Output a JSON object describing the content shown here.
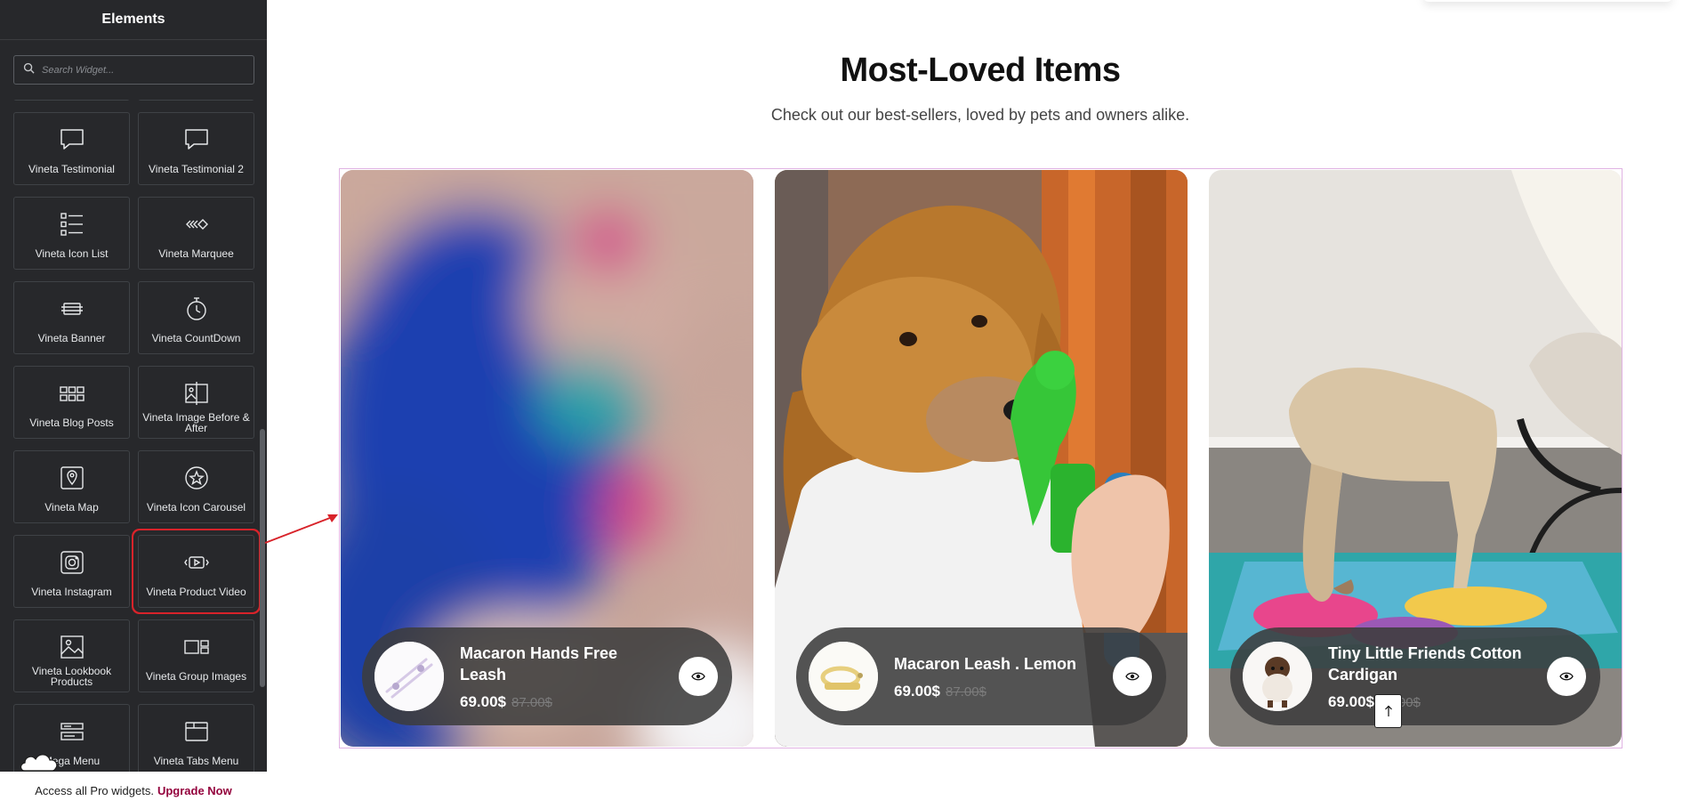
{
  "sidebar": {
    "title": "Elements",
    "search_placeholder": "Search Widget...",
    "widgets": [
      {
        "label": "Vineta Testimonial",
        "icon": "speech-bubble-icon"
      },
      {
        "label": "Vineta Testimonial 2",
        "icon": "speech-bubble-icon"
      },
      {
        "label": "Vineta Icon List",
        "icon": "icon-list-icon"
      },
      {
        "label": "Vineta Marquee",
        "icon": "marquee-icon"
      },
      {
        "label": "Vineta Banner",
        "icon": "banner-icon"
      },
      {
        "label": "Vineta CountDown",
        "icon": "stopwatch-icon"
      },
      {
        "label": "Vineta Blog Posts",
        "icon": "blog-grid-icon"
      },
      {
        "label": "Vineta Image Before & After",
        "icon": "image-compare-icon"
      },
      {
        "label": "Vineta Map",
        "icon": "map-pin-icon"
      },
      {
        "label": "Vineta Icon Carousel",
        "icon": "star-circle-icon"
      },
      {
        "label": "Vineta Instagram",
        "icon": "instagram-icon"
      },
      {
        "label": "Vineta Product Video",
        "icon": "video-play-icon"
      },
      {
        "label": "Vineta Lookbook Products",
        "icon": "lookbook-icon"
      },
      {
        "label": "Vineta Group Images",
        "icon": "group-images-icon"
      },
      {
        "label": "Mega Menu",
        "icon": "mega-menu-icon"
      },
      {
        "label": "Vineta Tabs Menu",
        "icon": "tabs-menu-icon"
      }
    ],
    "highlighted_widget": "Vineta Product Video",
    "promo_text": "Access all Pro widgets.",
    "promo_link": "Upgrade Now"
  },
  "section": {
    "heading": "Most-Loved Items",
    "subheading": "Check out our best-sellers, loved by pets and owners alike."
  },
  "products": [
    {
      "name": "Macaron Hands Free Leash",
      "price": "69.00$",
      "old_price": "87.00$",
      "photo": "blurred-blue-toy"
    },
    {
      "name": "Macaron Leash . Lemon",
      "price": "69.00$",
      "old_price": "87.00$",
      "photo": "golden-retriever-with-toy"
    },
    {
      "name": "Tiny Little Friends Cotton Cardigan",
      "price": "69.00$",
      "old_price": "87.00$",
      "photo": "dog-sniffing-play-mat"
    }
  ],
  "colors": {
    "sidebar_bg": "#27282b",
    "highlight": "#d8232a",
    "upgrade_link": "#93003c",
    "frame_border": "#e0b3e3"
  }
}
